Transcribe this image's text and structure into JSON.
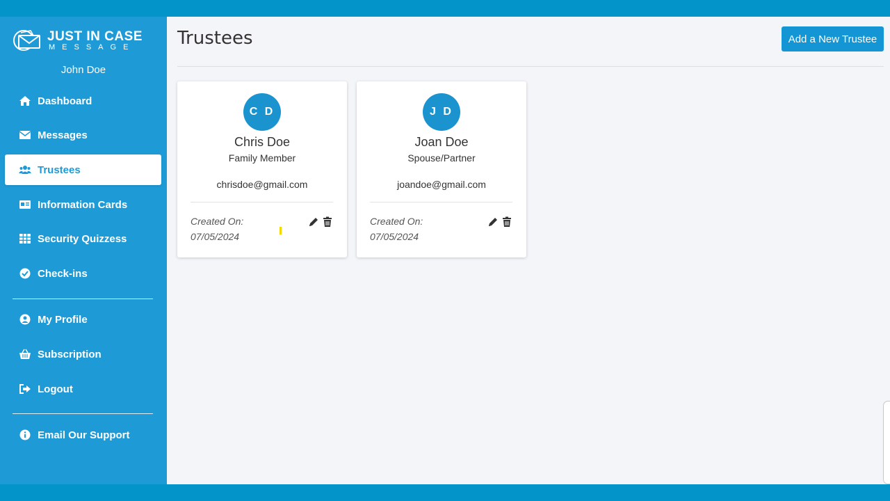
{
  "app": {
    "logo_line1": "JUST IN CASE",
    "logo_line2": "MESSAGE"
  },
  "user": {
    "name": "John Doe"
  },
  "sidebar": {
    "items": [
      {
        "label": "Dashboard",
        "icon": "home-icon"
      },
      {
        "label": "Messages",
        "icon": "envelope-icon"
      },
      {
        "label": "Trustees",
        "icon": "users-icon",
        "active": true
      },
      {
        "label": "Information Cards",
        "icon": "id-card-icon"
      },
      {
        "label": "Security Quizzess",
        "icon": "grid-icon"
      },
      {
        "label": "Check-ins",
        "icon": "check-circle-icon"
      }
    ],
    "account_items": [
      {
        "label": "My Profile",
        "icon": "user-circle-icon"
      },
      {
        "label": "Subscription",
        "icon": "basket-icon"
      },
      {
        "label": "Logout",
        "icon": "sign-out-icon"
      }
    ],
    "support_items": [
      {
        "label": "Email Our Support",
        "icon": "info-circle-icon"
      }
    ]
  },
  "main": {
    "title": "Trustees",
    "add_button_label": "Add a New Trustee"
  },
  "trustees": [
    {
      "initials": "C D",
      "name": "Chris Doe",
      "relationship": "Family Member",
      "email": "chrisdoe@gmail.com",
      "created_label": "Created On:",
      "created_date": "07/05/2024"
    },
    {
      "initials": "J D",
      "name": "Joan Doe",
      "relationship": "Spouse/Partner",
      "email": "joandoe@gmail.com",
      "created_label": "Created On:",
      "created_date": "07/05/2024"
    }
  ],
  "colors": {
    "primary": "#1e9bd7",
    "frame": "#0394c9",
    "background": "#f4f5f9",
    "avatar": "#1a93cf"
  }
}
